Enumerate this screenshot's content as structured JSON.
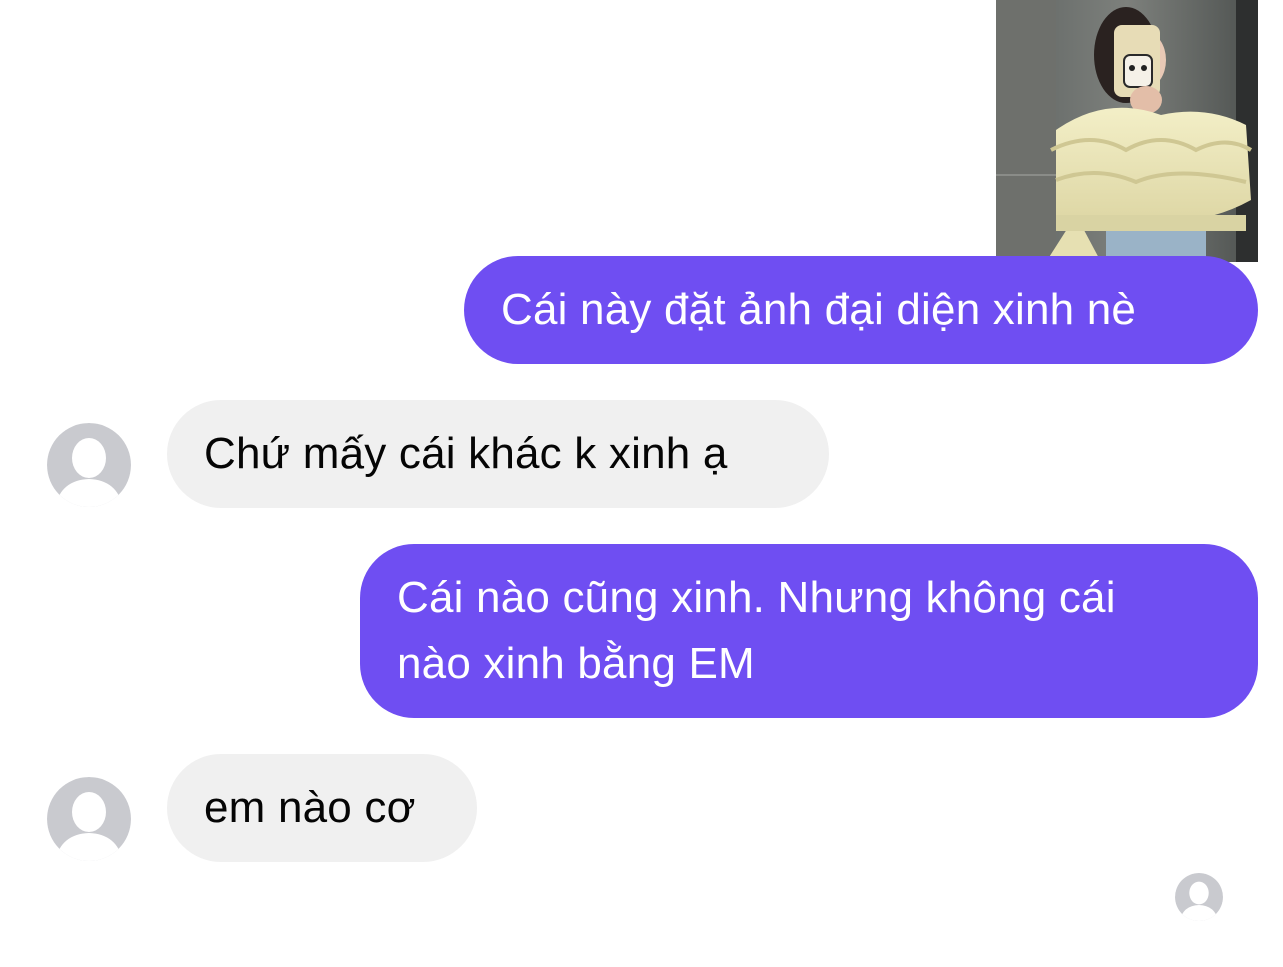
{
  "conversation": {
    "shared_image": {
      "icon": "photo-thumbnail"
    },
    "messages": [
      {
        "direction": "outgoing",
        "text": "Cái này đặt ảnh đại diện xinh nè"
      },
      {
        "direction": "incoming",
        "text": "Chứ mấy cái khác k xinh ạ"
      },
      {
        "direction": "outgoing",
        "lines": [
          "Cái nào cũng xinh. Nhưng không cái",
          "nào xinh bằng EM"
        ]
      },
      {
        "direction": "incoming",
        "text": "em nào cơ"
      }
    ],
    "read_receipt": {
      "icon": "avatar-placeholder-icon"
    }
  },
  "colors": {
    "outgoing_bubble": "#6f4ef2",
    "incoming_bubble": "#f0f0f0",
    "avatar_placeholder": "#c9cacf"
  }
}
